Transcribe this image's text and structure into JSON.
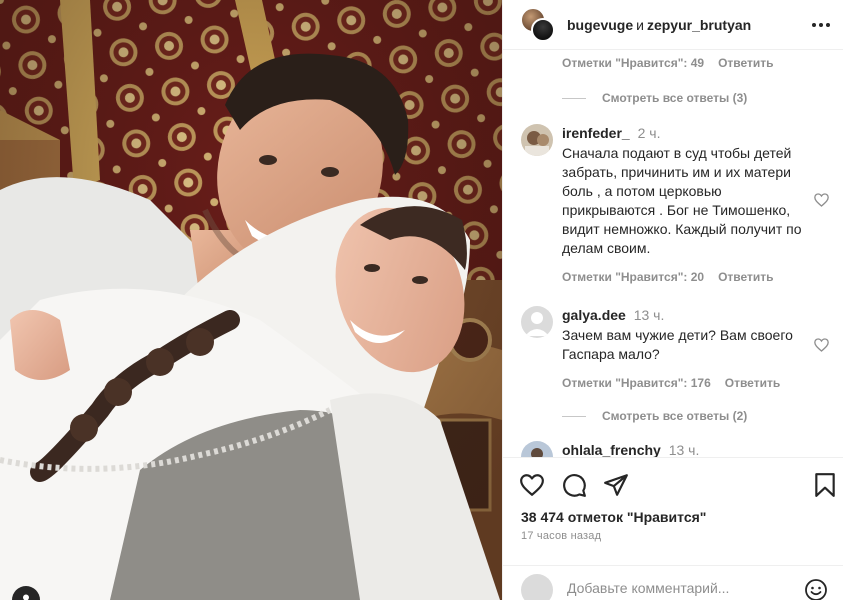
{
  "header": {
    "user1": "bugevuge",
    "conjunction": "и",
    "user2": "zepyur_brutyan",
    "more_icon": "more-horizontal-icon"
  },
  "comments": {
    "top_meta": {
      "likes": "Отметки \"Нравится\": 49",
      "reply": "Ответить"
    },
    "view_replies_1": "Смотреть все ответы (3)",
    "items": [
      {
        "username": "irenfeder_",
        "time": "2 ч.",
        "text": "Сначала подают в суд чтобы детей забрать, причинить им и их матери боль , а потом церковью прикрываются . Бог не Тимошенко, видит немножко. Каждый получит по делам своим.",
        "likes": "Отметки \"Нравится\": 20",
        "reply": "Ответить"
      },
      {
        "username": "galya.dee",
        "time": "13 ч.",
        "text": "Зачем вам чужие дети? Вам своего Гаспара мало?",
        "likes": "Отметки \"Нравится\": 176",
        "reply": "Ответить"
      },
      {
        "username": "ohlala_frenchy",
        "time": "13 ч."
      }
    ],
    "view_replies_2": "Смотреть все ответы (2)"
  },
  "actions": {
    "icons": [
      "heart-icon",
      "comment-icon",
      "share-icon",
      "bookmark-icon"
    ],
    "likes": "38 474 отметок \"Нравится\"",
    "time": "17 часов назад"
  },
  "add_comment": {
    "placeholder": "Добавьте комментарий..."
  }
}
